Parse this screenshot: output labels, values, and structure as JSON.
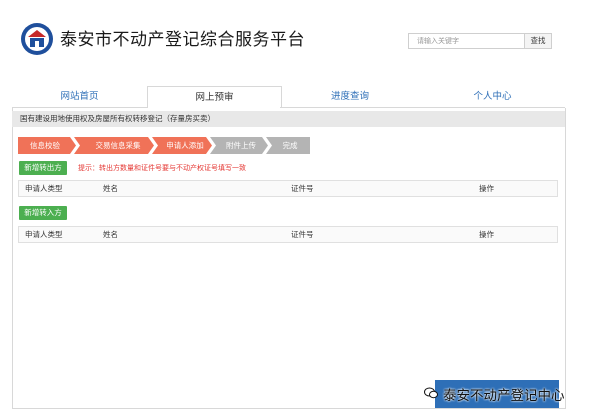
{
  "header": {
    "site_title": "泰安市不动产登记综合服务平台",
    "search_placeholder": "请输入关键字",
    "search_button": "查找"
  },
  "nav": {
    "tabs": [
      {
        "label": "网站首页",
        "active": false
      },
      {
        "label": "网上预审",
        "active": true
      },
      {
        "label": "进度查询",
        "active": false
      },
      {
        "label": "个人中心",
        "active": false
      }
    ]
  },
  "panel": {
    "title": "国有建设用地使用权及房屋所有权转移登记（存量房买卖）",
    "steps": [
      {
        "label": "信息校验",
        "state": "done"
      },
      {
        "label": "交易信息采集",
        "state": "done"
      },
      {
        "label": "申请人添加",
        "state": "current"
      },
      {
        "label": "附件上传",
        "state": "pending"
      },
      {
        "label": "完成",
        "state": "pending"
      }
    ],
    "step_colors": {
      "done": "#f07258",
      "current": "#f07258",
      "pending": "#b4b4b4"
    },
    "add_seller_button": "新增转出方",
    "hint": "提示：转出方数量和证件号要与不动产权证号填写一致",
    "seller_table": {
      "headers": [
        "申请人类型",
        "姓名",
        "证件号",
        "操作"
      ]
    },
    "add_buyer_button": "新增转入方",
    "buyer_table": {
      "headers": [
        "申请人类型",
        "姓名",
        "证件号",
        "操作"
      ]
    }
  },
  "watermark": {
    "text": "泰安不动产登记中心"
  }
}
